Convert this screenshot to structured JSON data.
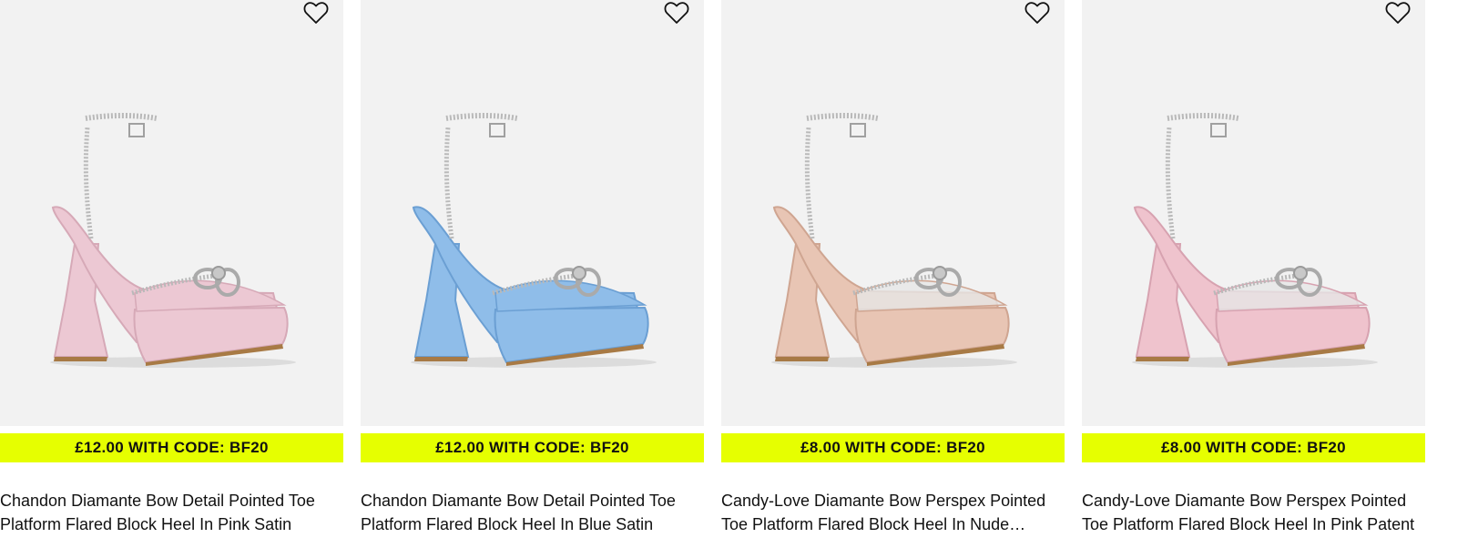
{
  "products": [
    {
      "promo": "£12.00 WITH CODE: BF20",
      "title": "Chandon Diamante Bow Detail Pointed Toe Platform Flared Block Heel In Pink Satin",
      "colors": {
        "body": "#ecc8d3",
        "shade": "#d6a9b7",
        "sole": "#a87a45"
      }
    },
    {
      "promo": "£12.00 WITH CODE: BF20",
      "title": "Chandon Diamante Bow Detail Pointed Toe Platform Flared Block Heel In Blue Satin",
      "colors": {
        "body": "#8fbde9",
        "shade": "#6b9fd3",
        "sole": "#a87a45"
      }
    },
    {
      "promo": "£8.00 WITH CODE: BF20",
      "title": "Candy-Love Diamante Bow Perspex Pointed Toe Platform Flared Block Heel In Nude Patent",
      "colors": {
        "body": "#e8c5b4",
        "shade": "#cfa591",
        "sole": "#a87a45"
      }
    },
    {
      "promo": "£8.00 WITH CODE: BF20",
      "title": "Candy-Love Diamante Bow Perspex Pointed Toe Platform Flared Block Heel In Pink Patent",
      "colors": {
        "body": "#efc3cd",
        "shade": "#d7a2b0",
        "sole": "#a87a45"
      }
    }
  ],
  "icons": {
    "wishlist": "heart-outline-icon"
  },
  "promo_color": "#e6ff00"
}
